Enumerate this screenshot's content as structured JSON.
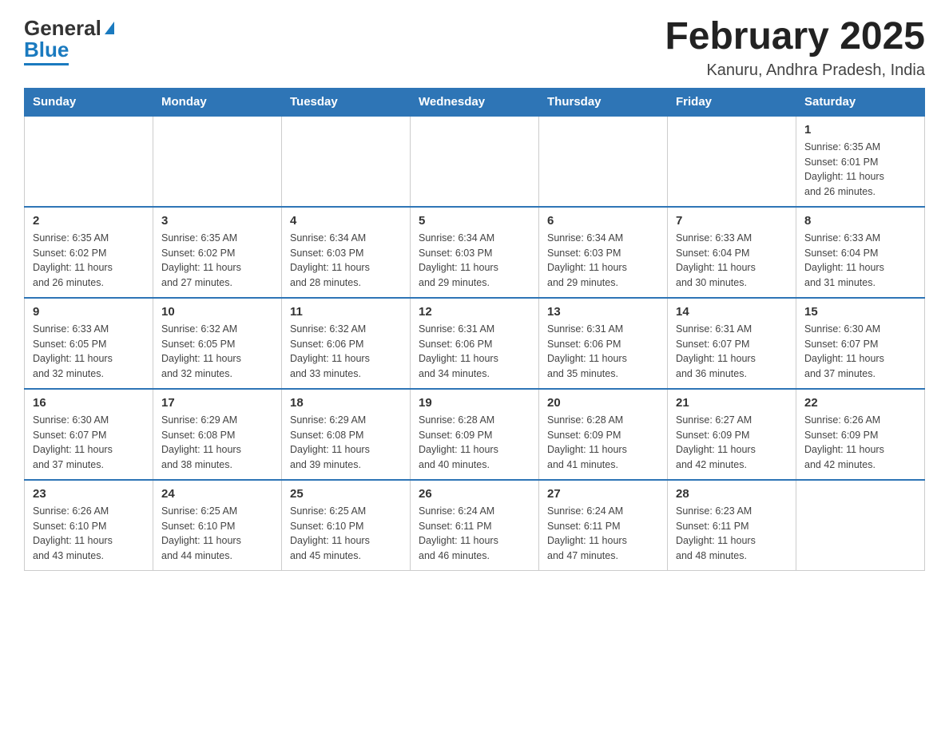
{
  "header": {
    "month_title": "February 2025",
    "location": "Kanuru, Andhra Pradesh, India",
    "logo_general": "General",
    "logo_blue": "Blue"
  },
  "weekdays": [
    "Sunday",
    "Monday",
    "Tuesday",
    "Wednesday",
    "Thursday",
    "Friday",
    "Saturday"
  ],
  "weeks": [
    [
      {
        "day": "",
        "info": ""
      },
      {
        "day": "",
        "info": ""
      },
      {
        "day": "",
        "info": ""
      },
      {
        "day": "",
        "info": ""
      },
      {
        "day": "",
        "info": ""
      },
      {
        "day": "",
        "info": ""
      },
      {
        "day": "1",
        "info": "Sunrise: 6:35 AM\nSunset: 6:01 PM\nDaylight: 11 hours\nand 26 minutes."
      }
    ],
    [
      {
        "day": "2",
        "info": "Sunrise: 6:35 AM\nSunset: 6:02 PM\nDaylight: 11 hours\nand 26 minutes."
      },
      {
        "day": "3",
        "info": "Sunrise: 6:35 AM\nSunset: 6:02 PM\nDaylight: 11 hours\nand 27 minutes."
      },
      {
        "day": "4",
        "info": "Sunrise: 6:34 AM\nSunset: 6:03 PM\nDaylight: 11 hours\nand 28 minutes."
      },
      {
        "day": "5",
        "info": "Sunrise: 6:34 AM\nSunset: 6:03 PM\nDaylight: 11 hours\nand 29 minutes."
      },
      {
        "day": "6",
        "info": "Sunrise: 6:34 AM\nSunset: 6:03 PM\nDaylight: 11 hours\nand 29 minutes."
      },
      {
        "day": "7",
        "info": "Sunrise: 6:33 AM\nSunset: 6:04 PM\nDaylight: 11 hours\nand 30 minutes."
      },
      {
        "day": "8",
        "info": "Sunrise: 6:33 AM\nSunset: 6:04 PM\nDaylight: 11 hours\nand 31 minutes."
      }
    ],
    [
      {
        "day": "9",
        "info": "Sunrise: 6:33 AM\nSunset: 6:05 PM\nDaylight: 11 hours\nand 32 minutes."
      },
      {
        "day": "10",
        "info": "Sunrise: 6:32 AM\nSunset: 6:05 PM\nDaylight: 11 hours\nand 32 minutes."
      },
      {
        "day": "11",
        "info": "Sunrise: 6:32 AM\nSunset: 6:06 PM\nDaylight: 11 hours\nand 33 minutes."
      },
      {
        "day": "12",
        "info": "Sunrise: 6:31 AM\nSunset: 6:06 PM\nDaylight: 11 hours\nand 34 minutes."
      },
      {
        "day": "13",
        "info": "Sunrise: 6:31 AM\nSunset: 6:06 PM\nDaylight: 11 hours\nand 35 minutes."
      },
      {
        "day": "14",
        "info": "Sunrise: 6:31 AM\nSunset: 6:07 PM\nDaylight: 11 hours\nand 36 minutes."
      },
      {
        "day": "15",
        "info": "Sunrise: 6:30 AM\nSunset: 6:07 PM\nDaylight: 11 hours\nand 37 minutes."
      }
    ],
    [
      {
        "day": "16",
        "info": "Sunrise: 6:30 AM\nSunset: 6:07 PM\nDaylight: 11 hours\nand 37 minutes."
      },
      {
        "day": "17",
        "info": "Sunrise: 6:29 AM\nSunset: 6:08 PM\nDaylight: 11 hours\nand 38 minutes."
      },
      {
        "day": "18",
        "info": "Sunrise: 6:29 AM\nSunset: 6:08 PM\nDaylight: 11 hours\nand 39 minutes."
      },
      {
        "day": "19",
        "info": "Sunrise: 6:28 AM\nSunset: 6:09 PM\nDaylight: 11 hours\nand 40 minutes."
      },
      {
        "day": "20",
        "info": "Sunrise: 6:28 AM\nSunset: 6:09 PM\nDaylight: 11 hours\nand 41 minutes."
      },
      {
        "day": "21",
        "info": "Sunrise: 6:27 AM\nSunset: 6:09 PM\nDaylight: 11 hours\nand 42 minutes."
      },
      {
        "day": "22",
        "info": "Sunrise: 6:26 AM\nSunset: 6:09 PM\nDaylight: 11 hours\nand 42 minutes."
      }
    ],
    [
      {
        "day": "23",
        "info": "Sunrise: 6:26 AM\nSunset: 6:10 PM\nDaylight: 11 hours\nand 43 minutes."
      },
      {
        "day": "24",
        "info": "Sunrise: 6:25 AM\nSunset: 6:10 PM\nDaylight: 11 hours\nand 44 minutes."
      },
      {
        "day": "25",
        "info": "Sunrise: 6:25 AM\nSunset: 6:10 PM\nDaylight: 11 hours\nand 45 minutes."
      },
      {
        "day": "26",
        "info": "Sunrise: 6:24 AM\nSunset: 6:11 PM\nDaylight: 11 hours\nand 46 minutes."
      },
      {
        "day": "27",
        "info": "Sunrise: 6:24 AM\nSunset: 6:11 PM\nDaylight: 11 hours\nand 47 minutes."
      },
      {
        "day": "28",
        "info": "Sunrise: 6:23 AM\nSunset: 6:11 PM\nDaylight: 11 hours\nand 48 minutes."
      },
      {
        "day": "",
        "info": ""
      }
    ]
  ]
}
